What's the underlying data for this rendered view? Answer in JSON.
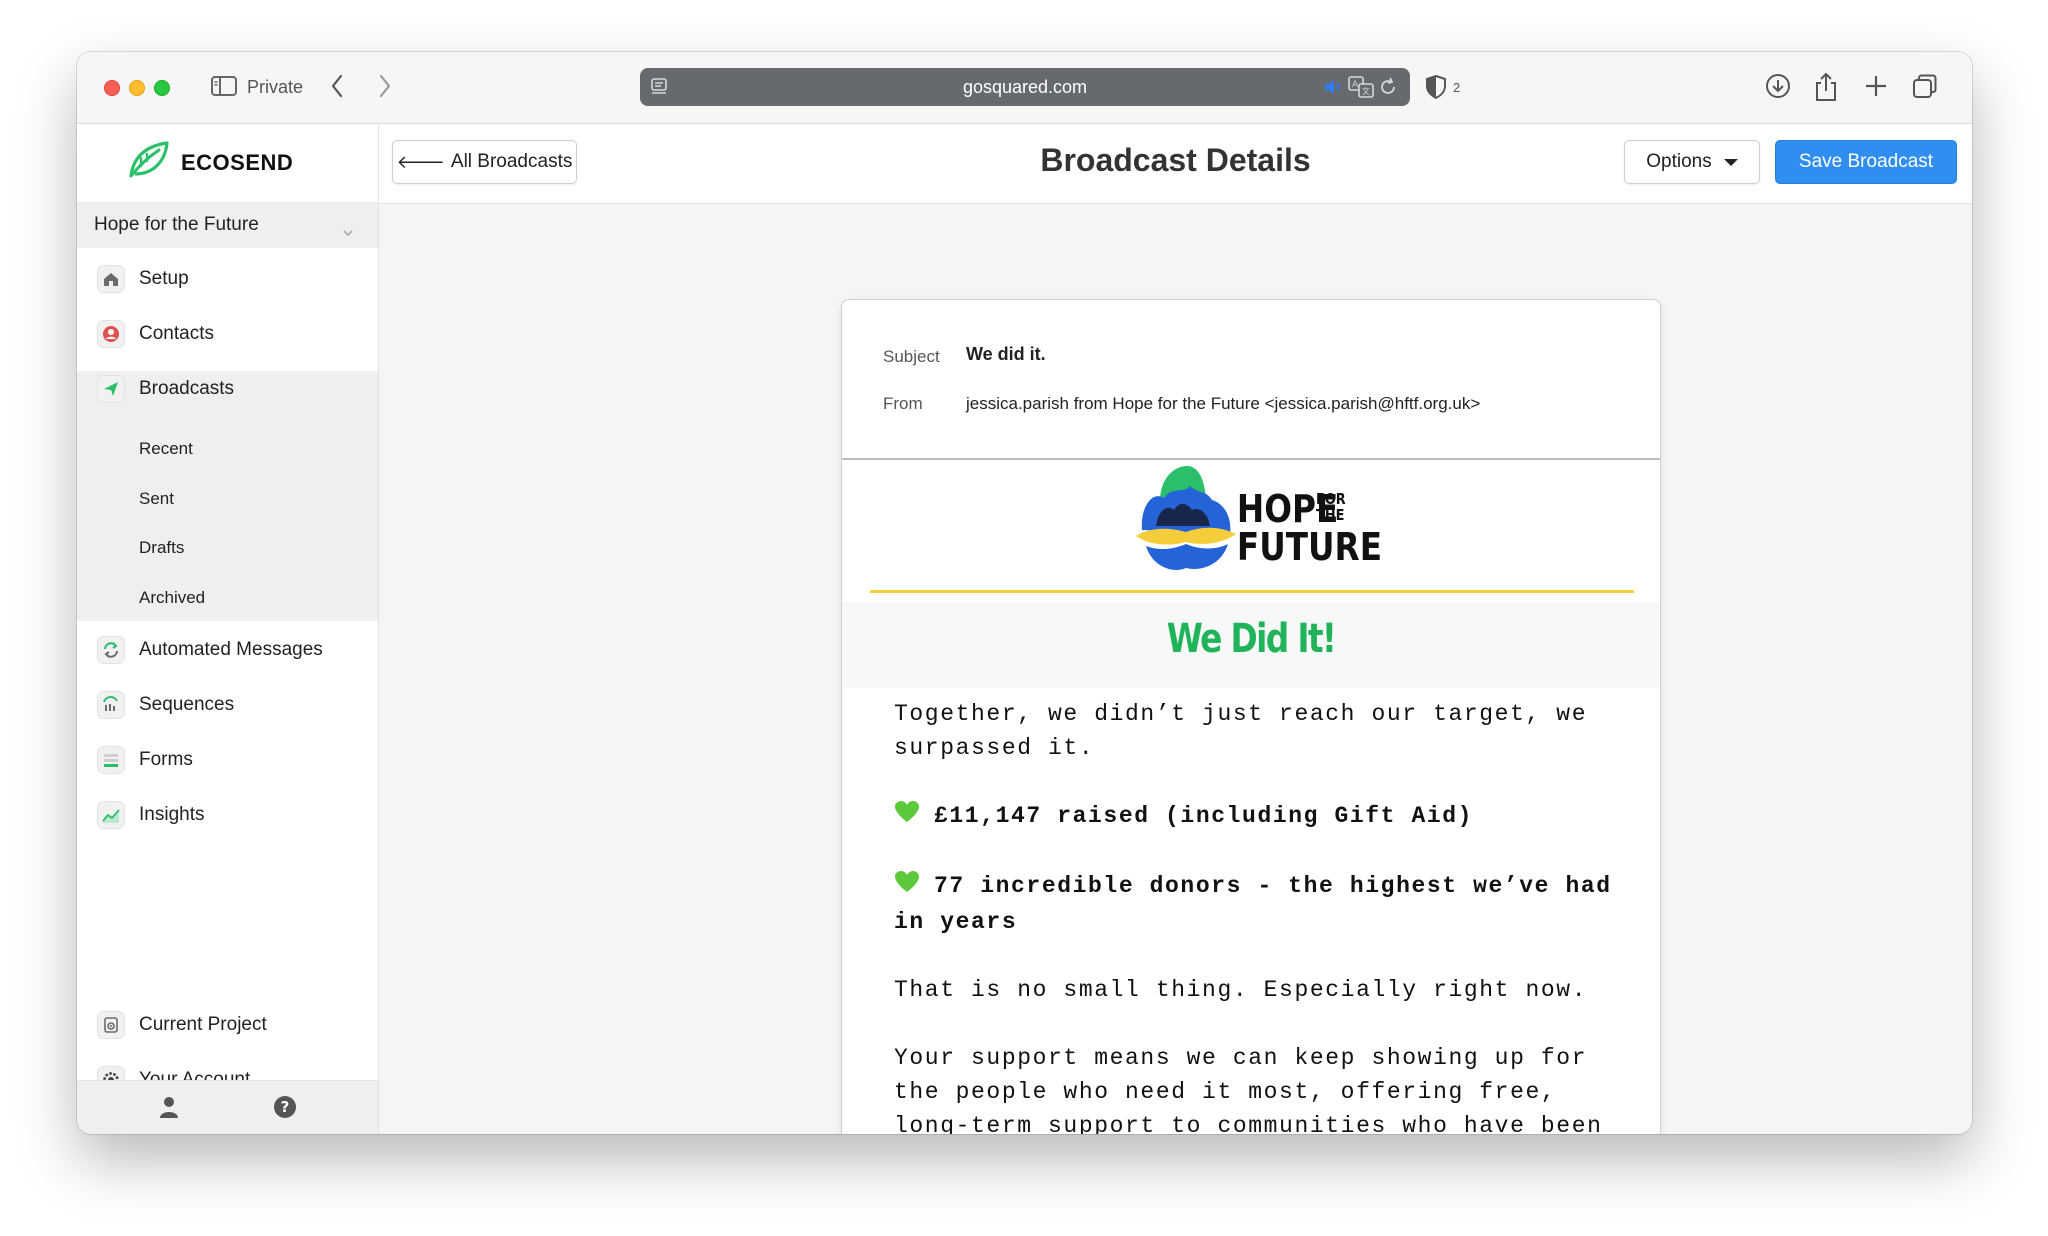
{
  "browser": {
    "private_label": "Private",
    "url": "gosquared.com",
    "tracker_count": "2"
  },
  "sidebar": {
    "brand_name": "ECOSEND",
    "project": "Hope for the Future",
    "items": [
      {
        "label": "Setup",
        "icon": "home-icon"
      },
      {
        "label": "Contacts",
        "icon": "contact-icon"
      },
      {
        "label": "Broadcasts",
        "icon": "send-icon"
      },
      {
        "label": "Automated Messages",
        "icon": "repeat-icon"
      },
      {
        "label": "Sequences",
        "icon": "sequence-icon"
      },
      {
        "label": "Forms",
        "icon": "form-icon"
      },
      {
        "label": "Insights",
        "icon": "chart-icon"
      },
      {
        "label": "Current Project",
        "icon": "project-icon"
      },
      {
        "label": "Your Account",
        "icon": "settings-icon"
      }
    ],
    "broadcast_subitems": [
      "Recent",
      "Sent",
      "Drafts",
      "Archived"
    ]
  },
  "header": {
    "back_label": "All Broadcasts",
    "title": "Broadcast Details",
    "options_label": "Options",
    "save_label": "Save Broadcast"
  },
  "email": {
    "subject_label": "Subject",
    "subject": "We did it.",
    "from_label": "From",
    "from": "jessica.parish from Hope for the Future <jessica.parish@hftf.org.uk>",
    "logo_text_1": "HOPE",
    "logo_text_for": "FOR",
    "logo_text_the": "THE",
    "logo_text_2": "FUTURE",
    "headline": "We Did It!",
    "paragraphs": [
      "Together, we didn’t just reach our target, we surpassed it.",
      "£11,147 raised (including Gift Aid)",
      "77 incredible donors - the highest we’ve had in years",
      "That is no small thing. Especially right now.",
      "Your support means we can keep showing up for the people who need it most, offering free, long-term support to communities who have been"
    ]
  },
  "colors": {
    "accent_blue": "#2f8ef0",
    "headline_green": "#21b35a",
    "brand_green": "#2bbf6a",
    "logo_yellow": "#f5cc3a"
  }
}
